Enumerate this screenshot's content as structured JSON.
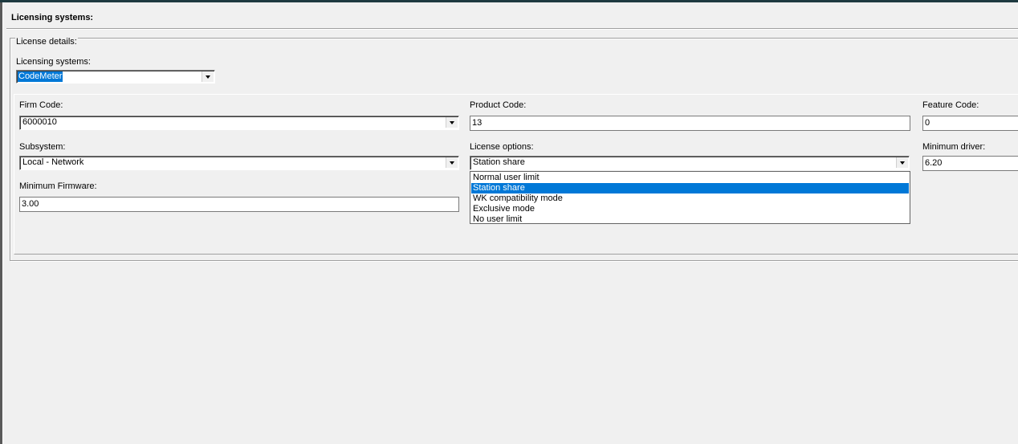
{
  "header": {
    "title": "Licensing systems:"
  },
  "license_details": {
    "legend": "License details:",
    "licensing_systems_label": "Licensing systems:",
    "licensing_systems_value": "CodeMeter"
  },
  "fields": {
    "firm_code_label": "Firm Code:",
    "firm_code_value": "6000010",
    "product_code_label": "Product Code:",
    "product_code_value": "13",
    "feature_code_label": "Feature Code:",
    "feature_code_value": "0",
    "subsystem_label": "Subsystem:",
    "subsystem_value": "Local - Network",
    "license_options_label": "License options:",
    "license_options_value": "Station share",
    "minimum_driver_label": "Minimum driver:",
    "minimum_driver_value": "6.20",
    "minimum_firmware_label": "Minimum Firmware:",
    "minimum_firmware_value": "3.00"
  },
  "license_options_list": {
    "items": [
      "Normal user limit",
      "Station share",
      "WK compatibility mode",
      "Exclusive mode",
      "No user limit"
    ],
    "selected_index": 1
  },
  "icons": {
    "dropdown_arrow": "chevron-down-icon"
  },
  "colors": {
    "selection": "#0078d7",
    "background": "#f0f0f0"
  }
}
